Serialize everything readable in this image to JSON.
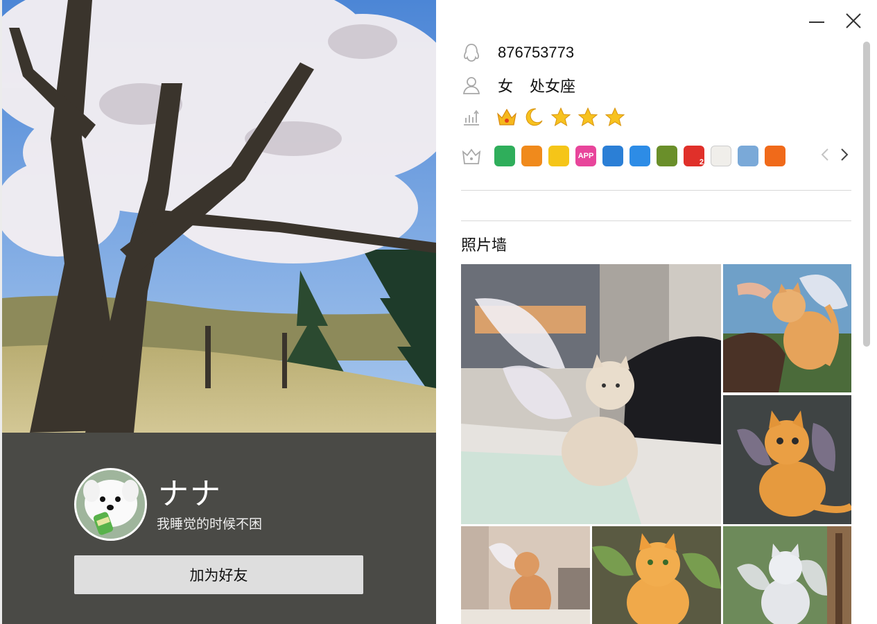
{
  "profile": {
    "nickname": "ナナ",
    "signature": "我睡觉的时候不困",
    "add_friend_label": "加为好友",
    "qq_number": "876753773",
    "gender": "女",
    "zodiac": "处女座"
  },
  "level": {
    "icons": [
      "crown-icon",
      "moon-icon",
      "star-icon",
      "star-icon",
      "star-icon"
    ]
  },
  "services": {
    "badges": [
      {
        "name": "vip-gem-badge",
        "text": "",
        "color": "#2fae5b"
      },
      {
        "name": "game-badge",
        "text": "",
        "color": "#f08a1c"
      },
      {
        "name": "star-badge",
        "text": "",
        "color": "#f5c518"
      },
      {
        "name": "app-badge",
        "text": "APP",
        "color": "#e8459b"
      },
      {
        "name": "camera-badge",
        "text": "",
        "color": "#2b7fd6"
      },
      {
        "name": "shield-badge",
        "text": "",
        "color": "#2d8ce6"
      },
      {
        "name": "minecraft-badge",
        "text": "",
        "color": "#6a8f2a"
      },
      {
        "name": "medal-badge",
        "text": "2",
        "color": "#e0302a"
      },
      {
        "name": "cow-badge",
        "text": "",
        "color": "#f0eeea"
      },
      {
        "name": "mail-badge",
        "text": "",
        "color": "#7aa9d8"
      },
      {
        "name": "orange-circle-badge",
        "text": "",
        "color": "#f06a1a"
      }
    ]
  },
  "photo_wall": {
    "title": "照片墙",
    "photos": [
      "fairy-kitten-desk",
      "fairy-kitten-finger",
      "fairy-kitten-sitting",
      "fairy-kitten-window",
      "fairy-kitten-green-wings",
      "fairy-white-cat"
    ]
  },
  "colors": {
    "left_panel_bg": "#4a4a46",
    "button_bg": "#dedede",
    "divider": "#d8d8d8"
  }
}
